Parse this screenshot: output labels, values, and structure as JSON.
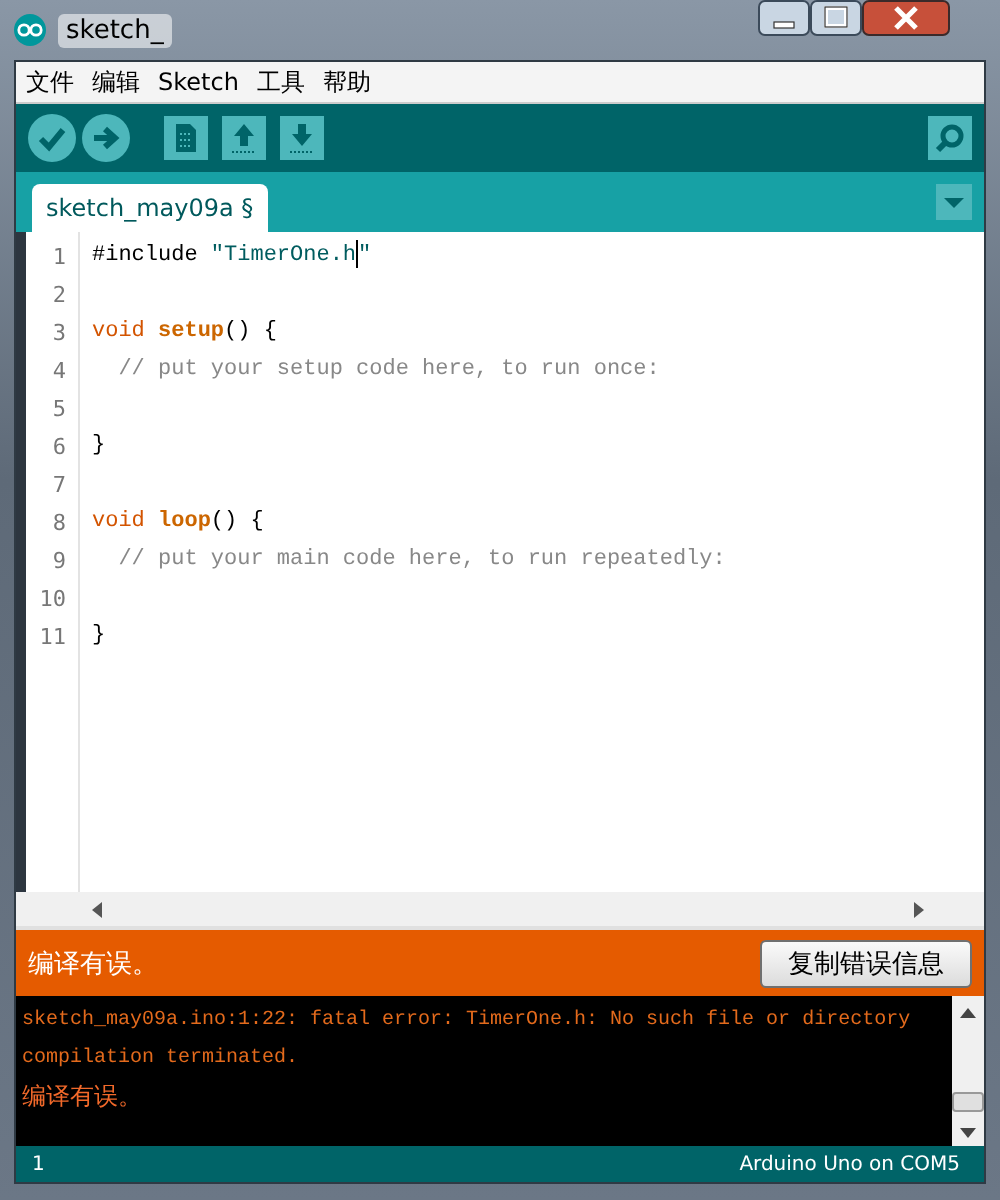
{
  "window": {
    "title": "sketch_"
  },
  "menu": [
    "文件",
    "编辑",
    "Sketch",
    "工具",
    "帮助"
  ],
  "toolbar": [
    {
      "kind": "verify"
    },
    {
      "kind": "upload"
    },
    {
      "kind": "new"
    },
    {
      "kind": "open"
    },
    {
      "kind": "save"
    },
    {
      "kind": "monitor"
    }
  ],
  "tabs": [
    {
      "label": "sketch_may09a §",
      "selected": true
    }
  ],
  "editor": {
    "lines": [
      {
        "number": "1",
        "tokens": [
          {
            "kind": "plain",
            "text": "#include "
          },
          {
            "kind": "string",
            "text": "\"TimerOne.h",
            "caret_after": true
          },
          {
            "kind": "string",
            "text": "\""
          }
        ]
      },
      {
        "number": "2"
      },
      {
        "number": "3",
        "tokens": [
          {
            "kind": "keyword",
            "text": "void "
          },
          {
            "kind": "function",
            "text": "setup"
          },
          {
            "kind": "plain",
            "text": "() {"
          }
        ]
      },
      {
        "number": "4",
        "tokens": [
          {
            "kind": "comment",
            "text": "  // put your setup code here, to run once:"
          }
        ]
      },
      {
        "number": "5"
      },
      {
        "number": "6",
        "tokens": [
          {
            "kind": "plain",
            "text": "}"
          }
        ]
      },
      {
        "number": "7"
      },
      {
        "number": "8",
        "tokens": [
          {
            "kind": "keyword",
            "text": "void "
          },
          {
            "kind": "function",
            "text": "loop"
          },
          {
            "kind": "plain",
            "text": "() {"
          }
        ]
      },
      {
        "number": "9",
        "tokens": [
          {
            "kind": "comment",
            "text": "  // put your main code here, to run repeatedly:"
          }
        ]
      },
      {
        "number": "10"
      },
      {
        "number": "11",
        "tokens": [
          {
            "kind": "plain",
            "text": "}"
          }
        ]
      }
    ]
  },
  "notice": {
    "message": "编译有误。",
    "button": "复制错误信息"
  },
  "console": [
    {
      "kind": "output",
      "text": "sketch_may09a.ino:1:22: fatal error: TimerOne.h: No such file or directory"
    },
    {
      "kind": "output",
      "text": "compilation terminated."
    },
    {
      "kind": "message",
      "text": "编译有误。"
    }
  ],
  "status_bar": {
    "line": "1",
    "board": "Arduino Uno on COM5"
  }
}
